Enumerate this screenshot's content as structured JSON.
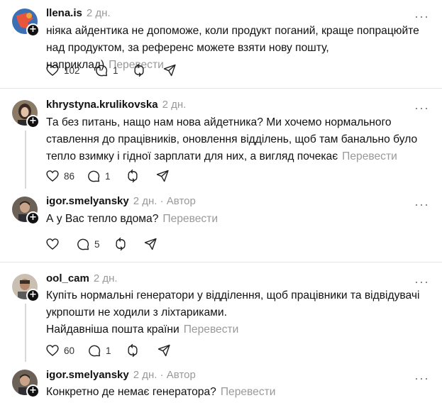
{
  "translate_label": "Перевести",
  "posts": [
    {
      "username": "llena.is",
      "time": "2 дн.",
      "author": "",
      "text": "ніяка айдентика не допоможе, коли продукт поганий, краще попрацюйте над продуктом, за референс можете взяти нову пошту, наприклад)",
      "likes": "102",
      "replies": "1",
      "reposts": "",
      "shares": ""
    },
    {
      "username": "khrystyna.krulikovska",
      "time": "2 дн.",
      "author": "",
      "text": "Та без питань, нащо нам нова айдетника? Ми хочемо нормального ставлення до працівників, оновлення відділень, щоб там банально було тепло взимку і гідної зарплати для них, а вигляд почекає",
      "likes": "86",
      "replies": "1",
      "reposts": "",
      "shares": ""
    },
    {
      "username": "igor.smelyansky",
      "time": "2 дн.",
      "author": "Автор",
      "text": "А у Вас тепло вдома?",
      "likes": "",
      "replies": "5",
      "reposts": "",
      "shares": ""
    },
    {
      "username": "ool_cam",
      "time": "2 дн.",
      "author": "",
      "text_lines": [
        "Купіть нормальні генератори у відділення, щоб працівники та відвідувачі укрпошти не ходили з ліхтариками.",
        "Найдавніша пошта країни"
      ],
      "likes": "60",
      "replies": "1",
      "reposts": "",
      "shares": ""
    },
    {
      "username": "igor.smelyansky",
      "time": "2 дн.",
      "author": "Автор",
      "text": "Конкретно де немає генератора?",
      "likes": "",
      "replies": "",
      "reposts": "",
      "shares": ""
    }
  ],
  "icons": [
    "heart-icon",
    "reply-icon",
    "repost-icon",
    "share-icon",
    "more-icon",
    "follow-plus-icon"
  ]
}
